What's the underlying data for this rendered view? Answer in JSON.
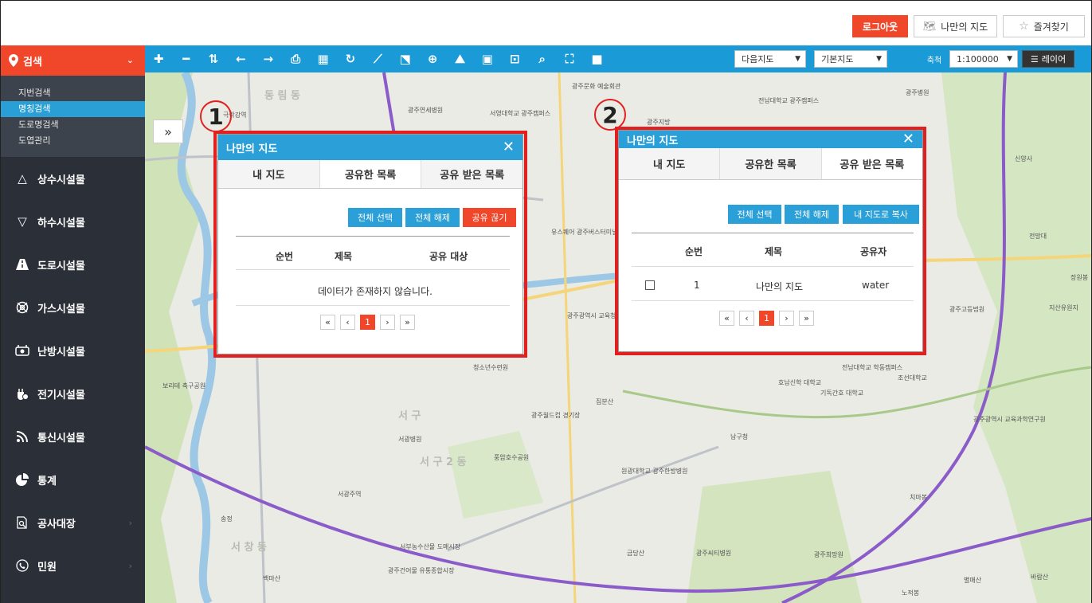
{
  "header": {
    "logout_label": "로그아웃",
    "my_map_label": "나만의 지도",
    "favorites_label": "즐겨찾기"
  },
  "sidebar": {
    "search_label": "검색",
    "sub_items": [
      "지번검색",
      "명칭검색",
      "도로명검색",
      "도엽관리"
    ],
    "active_sub_item": "명칭검색",
    "items": [
      {
        "label": "상수시설물",
        "icon": "triangle-up-icon"
      },
      {
        "label": "하수시설물",
        "icon": "triangle-down-icon"
      },
      {
        "label": "도로시설물",
        "icon": "road-icon"
      },
      {
        "label": "가스시설물",
        "icon": "gas-icon"
      },
      {
        "label": "난방시설물",
        "icon": "heating-icon"
      },
      {
        "label": "전기시설물",
        "icon": "electric-icon"
      },
      {
        "label": "통신시설물",
        "icon": "wifi-icon"
      },
      {
        "label": "통계",
        "icon": "pie-chart-icon"
      },
      {
        "label": "공사대장",
        "icon": "document-search-icon"
      },
      {
        "label": "민원",
        "icon": "phone-icon"
      }
    ]
  },
  "toolbar": {
    "map_select": "다음지도",
    "base_select": "기본지도",
    "scale_label": "축척",
    "scale_value": "1:100000",
    "layer_label": "레이어"
  },
  "map_labels": {
    "l1": "동 림 동",
    "l2": "광주연세병원",
    "l3": "서영대학교 광주캠퍼스",
    "l4": "광주문화 예술회관",
    "l5": "광주지방",
    "l6": "전남대학교 광주캠퍼스",
    "l7": "광주병원",
    "l8": "신양사",
    "l9": "유스퀘어 광주버스터미널",
    "l10": "광주광역시 교육청",
    "l11": "청소년수련원",
    "l12": "광주고등법원",
    "l13": "서 구",
    "l14": "서광병원",
    "l15": "광주월드컵 경기장",
    "l16": "풍암호수공원",
    "l17": "원광대학교 광주한방병원",
    "l18": "남구청",
    "l19": "전남대학교 학동캠퍼스",
    "l20": "조선대학교",
    "l21": "광주광역시 교육과학연구원",
    "l22": "치마봉",
    "l23": "서광주역",
    "l24": "서부농수산물 도매시장",
    "l25": "광주건어물 유통종합시장",
    "l26": "금당산",
    "l27": "광주씨티병원",
    "l28": "광주희망원",
    "l29": "별매산",
    "l30": "바람산",
    "l31": "노적봉",
    "l32": "백마산",
    "l33": "서 창 동",
    "l34": "호남신학 대학교",
    "l35": "기독간호 대학교",
    "l36": "서 구 2 동",
    "l37": "극락강역",
    "l38": "보리테 축구공원",
    "l39": "지산유원지",
    "l40": "장원봉",
    "l41": "전망대",
    "l42": "집분산",
    "l43": "송정"
  },
  "dialog1": {
    "title": "나만의 지도",
    "tabs": [
      "내 지도",
      "공유한 목록",
      "공유 받은 목록"
    ],
    "active_tab": "공유한 목록",
    "buttons": [
      "전체 선택",
      "전체 해제",
      "공유 끊기"
    ],
    "columns": [
      "순번",
      "제목",
      "공유 대상"
    ],
    "empty_message": "데이터가 존재하지 않습니다.",
    "pager": [
      "«",
      "‹",
      "1",
      "›",
      "»"
    ],
    "badge": "1"
  },
  "dialog2": {
    "title": "나만의 지도",
    "tabs": [
      "내 지도",
      "공유한 목록",
      "공유 받은 목록"
    ],
    "active_tab": "공유 받은 목록",
    "buttons": [
      "전체 선택",
      "전체 해제",
      "내 지도로 복사"
    ],
    "columns": [
      "순번",
      "제목",
      "공유자"
    ],
    "rows": [
      {
        "no": "1",
        "title": "나만의 지도",
        "sharer": "water"
      }
    ],
    "pager": [
      "«",
      "‹",
      "1",
      "›",
      "»"
    ],
    "badge": "2"
  },
  "colors": {
    "accent_blue": "#2b9fd8",
    "accent_red": "#f0472b",
    "sidebar_bg": "#2b3038",
    "highlight_outline": "#e32020"
  }
}
